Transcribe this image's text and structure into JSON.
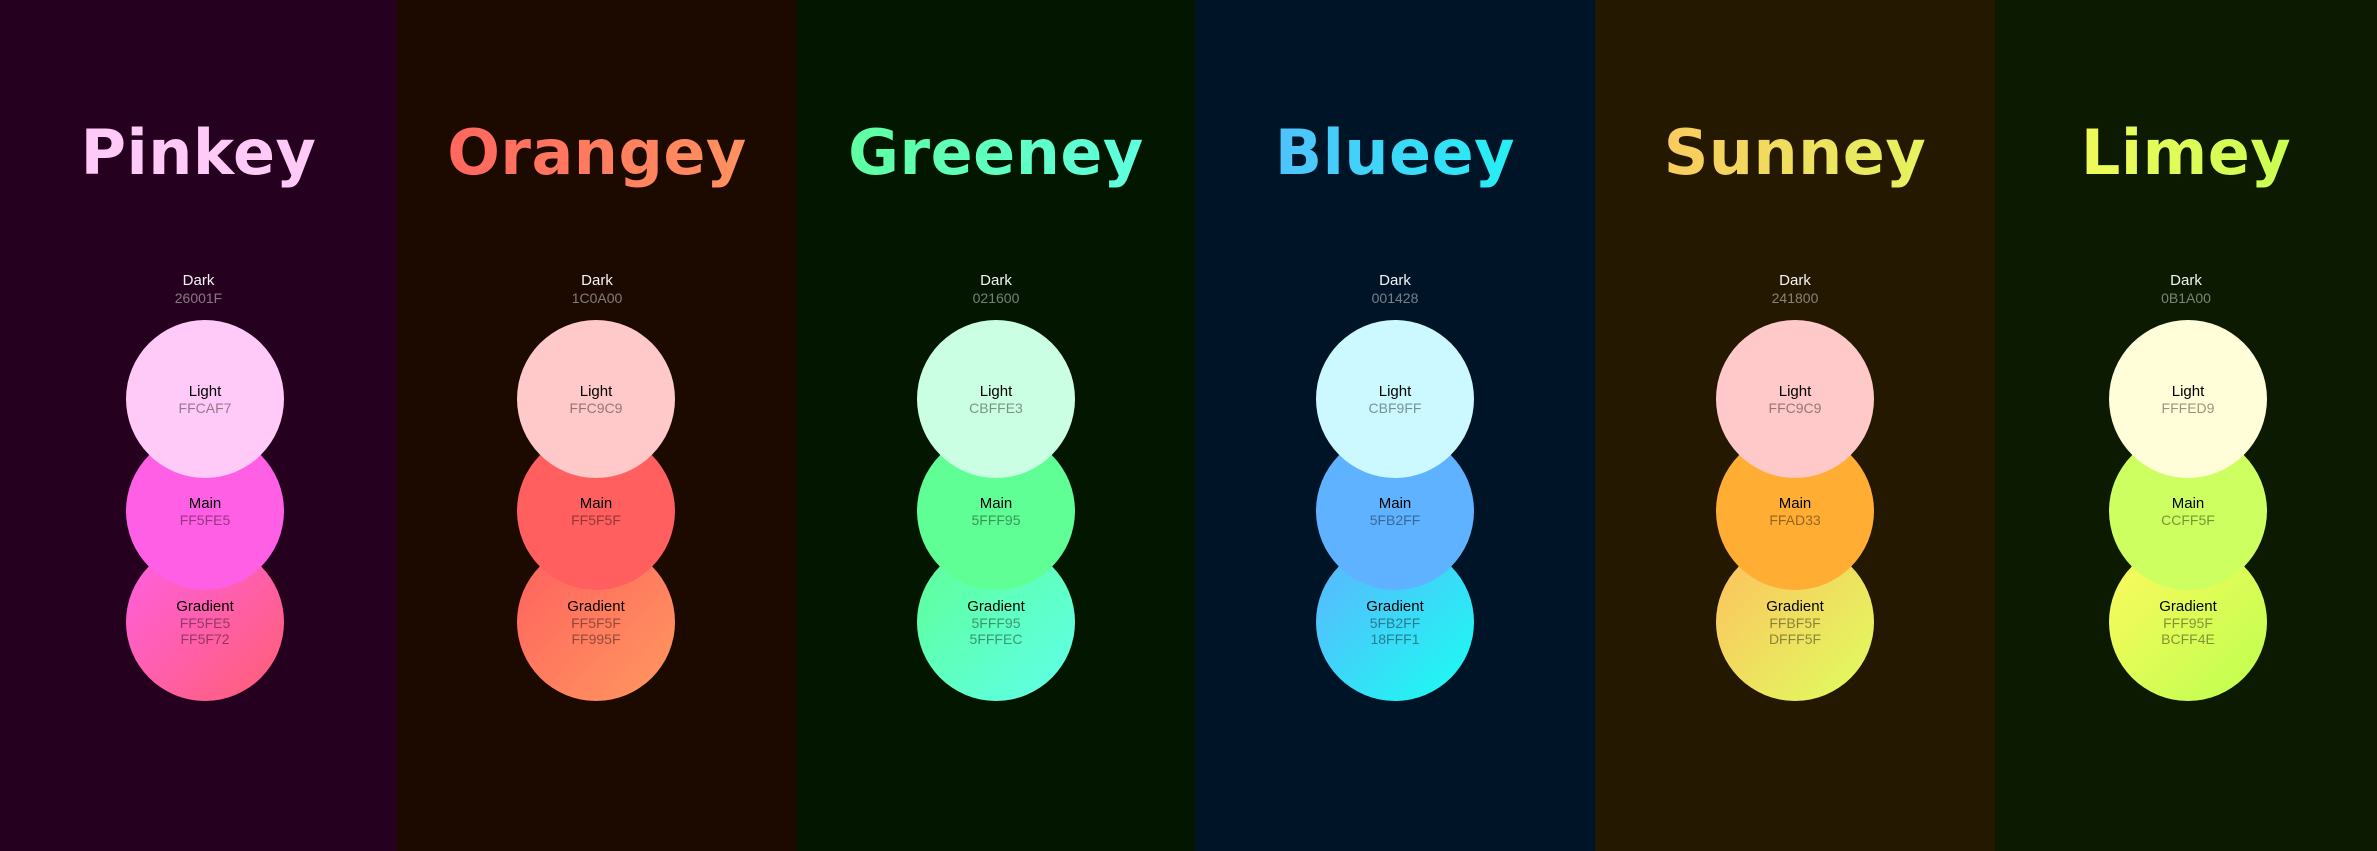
{
  "palettes": [
    {
      "name": "Pinkey",
      "bg": "#26001F",
      "title_gradient": [
        "#FFCAF7",
        "#FFCAF7"
      ],
      "dark": {
        "label": "Dark",
        "hex": "26001F"
      },
      "light": {
        "label": "Light",
        "hex": "FFCAF7",
        "color": "#FFCAF7"
      },
      "main": {
        "label": "Main",
        "hex": "FF5FE5",
        "color": "#FF5FE5"
      },
      "gradient": {
        "label": "Gradient",
        "hex1": "FF5FE5",
        "hex2": "FF5F72",
        "color1": "#FF5FE5",
        "color2": "#FF5F72"
      }
    },
    {
      "name": "Orangey",
      "bg": "#1C0A00",
      "title_gradient": [
        "#FF5F5F",
        "#FF995F"
      ],
      "dark": {
        "label": "Dark",
        "hex": "1C0A00"
      },
      "light": {
        "label": "Light",
        "hex": "FFC9C9",
        "color": "#FFC9C9"
      },
      "main": {
        "label": "Main",
        "hex": "FF5F5F",
        "color": "#FF5F5F"
      },
      "gradient": {
        "label": "Gradient",
        "hex1": "FF5F5F",
        "hex2": "FF995F",
        "color1": "#FF5F5F",
        "color2": "#FF995F"
      }
    },
    {
      "name": "Greeney",
      "bg": "#021600",
      "title_gradient": [
        "#5FFF95",
        "#5FFFEC"
      ],
      "dark": {
        "label": "Dark",
        "hex": "021600"
      },
      "light": {
        "label": "Light",
        "hex": "CBFFE3",
        "color": "#CBFFE3"
      },
      "main": {
        "label": "Main",
        "hex": "5FFF95",
        "color": "#5FFF95"
      },
      "gradient": {
        "label": "Gradient",
        "hex1": "5FFF95",
        "hex2": "5FFFEC",
        "color1": "#5FFF95",
        "color2": "#5FFFEC"
      }
    },
    {
      "name": "Blueey",
      "bg": "#001428",
      "title_gradient": [
        "#5FB2FF",
        "#18FFF1"
      ],
      "dark": {
        "label": "Dark",
        "hex": "001428"
      },
      "light": {
        "label": "Light",
        "hex": "CBF9FF",
        "color": "#CBF9FF"
      },
      "main": {
        "label": "Main",
        "hex": "5FB2FF",
        "color": "#5FB2FF"
      },
      "gradient": {
        "label": "Gradient",
        "hex1": "5FB2FF",
        "hex2": "18FFF1",
        "color1": "#5FB2FF",
        "color2": "#18FFF1"
      }
    },
    {
      "name": "Sunney",
      "bg": "#241800",
      "title_gradient": [
        "#FFBF5F",
        "#DFFF5F"
      ],
      "dark": {
        "label": "Dark",
        "hex": "241800"
      },
      "light": {
        "label": "Light",
        "hex": "FFC9C9",
        "color": "#FFC9C9"
      },
      "main": {
        "label": "Main",
        "hex": "FFAD33",
        "color": "#FFAD33"
      },
      "gradient": {
        "label": "Gradient",
        "hex1": "FFBF5F",
        "hex2": "DFFF5F",
        "color1": "#FFBF5F",
        "color2": "#DFFF5F"
      }
    },
    {
      "name": "Limey",
      "bg": "#0B1A00",
      "title_gradient": [
        "#FFF95F",
        "#BCFF4E"
      ],
      "dark": {
        "label": "Dark",
        "hex": "0B1A00"
      },
      "light": {
        "label": "Light",
        "hex": "FFFED9",
        "color": "#FFFED9"
      },
      "main": {
        "label": "Main",
        "hex": "CCFF5F",
        "color": "#CCFF5F"
      },
      "gradient": {
        "label": "Gradient",
        "hex1": "FFF95F",
        "hex2": "BCFF4E",
        "color1": "#FFF95F",
        "color2": "#BCFF4E"
      }
    }
  ]
}
